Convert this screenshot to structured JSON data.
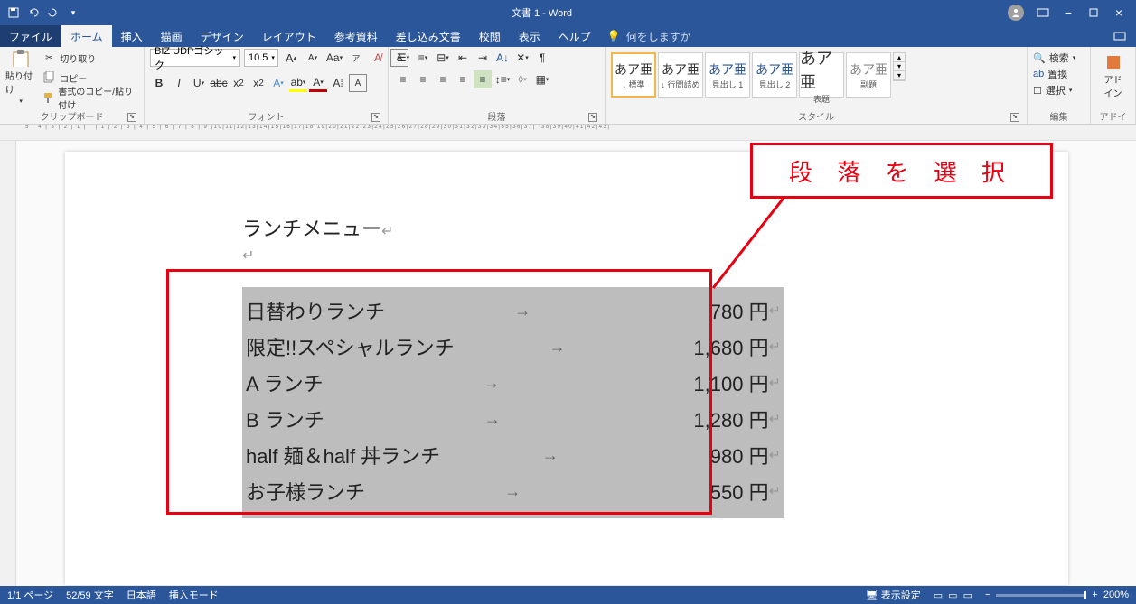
{
  "titlebar": {
    "title": "文書 1  -  Word"
  },
  "tabs": {
    "file": "ファイル",
    "items": [
      "ホーム",
      "挿入",
      "描画",
      "デザイン",
      "レイアウト",
      "参考資料",
      "差し込み文書",
      "校閲",
      "表示",
      "ヘルプ"
    ],
    "active_index": 0,
    "tellme": "何をしますか"
  },
  "ribbon": {
    "clipboard": {
      "paste": "貼り付け",
      "cut": "切り取り",
      "copy": "コピー",
      "format_painter": "書式のコピー/貼り付け",
      "label": "クリップボード"
    },
    "font": {
      "name": "BIZ UDPゴシック",
      "size": "10.5",
      "label": "フォント"
    },
    "paragraph": {
      "label": "段落"
    },
    "styles": {
      "label": "スタイル",
      "items": [
        {
          "sample": "あア亜",
          "name": "↓ 標準"
        },
        {
          "sample": "あア亜",
          "name": "↓ 行間詰め"
        },
        {
          "sample": "あア亜",
          "name": "見出し 1"
        },
        {
          "sample": "あア亜",
          "name": "見出し 2"
        },
        {
          "sample": "あア亜",
          "name": "表題"
        },
        {
          "sample": "あア亜",
          "name": "副題"
        }
      ]
    },
    "editing": {
      "find": "検索",
      "replace": "置換",
      "select": "選択",
      "label": "編集"
    },
    "addins": {
      "label": "アドイン",
      "btn": "アド\nイン"
    }
  },
  "document": {
    "title_line": "ランチメニュー",
    "callout": "段 落 を 選 択",
    "menu": [
      {
        "name": "日替わりランチ",
        "price": "780 円"
      },
      {
        "name": "限定!!スペシャルランチ",
        "price": "1,680 円"
      },
      {
        "name": "A ランチ",
        "price": "1,100 円"
      },
      {
        "name": "B ランチ",
        "price": "1,280 円"
      },
      {
        "name": "half 麺＆half 丼ランチ",
        "price": "980 円"
      },
      {
        "name": "お子様ランチ",
        "price": "550 円"
      }
    ]
  },
  "statusbar": {
    "page": "1/1 ページ",
    "words": "52/59 文字",
    "lang": "日本語",
    "mode": "挿入モード",
    "display": "表示設定",
    "zoom": "200%"
  }
}
